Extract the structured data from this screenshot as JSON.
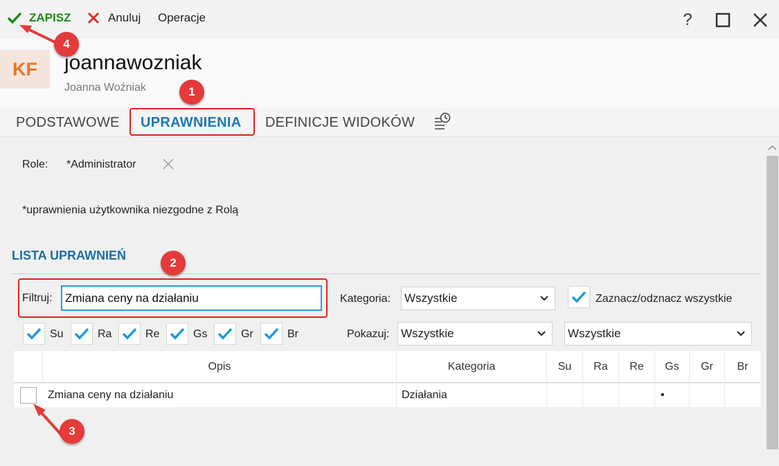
{
  "toolbar": {
    "save_label": "ZAPISZ",
    "cancel_label": "Anuluj",
    "operations_label": "Operacje",
    "help_label": "?"
  },
  "header": {
    "avatar_initials": "KF",
    "username": "joannawozniak",
    "full_name": "Joanna Woźniak"
  },
  "tabs": [
    {
      "label": "PODSTAWOWE",
      "active": false
    },
    {
      "label": "UPRAWNIENIA",
      "active": true
    },
    {
      "label": "DEFINICJE WIDOKÓW",
      "active": false
    }
  ],
  "roles": {
    "label": "Role:",
    "value": "*Administrator"
  },
  "note": "*uprawnienia użytkownika niezgodne z Rolą",
  "permissions": {
    "section_title": "LISTA UPRAWNIEŃ",
    "filter_label": "Filtruj:",
    "filter_value": "Zmiana ceny na działaniu",
    "category_label": "Kategoria:",
    "category_value": "Wszystkie",
    "select_all_label": "Zaznacz/odznacz wszystkie",
    "show_label": "Pokazuj:",
    "show_value": "Wszystkie",
    "show_value_2": "Wszystkie",
    "flags": [
      {
        "label": "Su",
        "checked": true
      },
      {
        "label": "Ra",
        "checked": true
      },
      {
        "label": "Re",
        "checked": true
      },
      {
        "label": "Gs",
        "checked": true
      },
      {
        "label": "Gr",
        "checked": true
      },
      {
        "label": "Br",
        "checked": true
      }
    ]
  },
  "table": {
    "columns": [
      "Opis",
      "Kategoria",
      "Su",
      "Ra",
      "Re",
      "Gs",
      "Gr",
      "Br"
    ],
    "rows": [
      {
        "checked": false,
        "opis": "Zmiana ceny na działaniu",
        "kategoria": "Działania",
        "su": "",
        "ra": "",
        "re": "",
        "gs": "•",
        "gr": "",
        "br": ""
      }
    ]
  },
  "annotations": [
    "1",
    "2",
    "3",
    "4"
  ],
  "colors": {
    "accent_blue": "#1c79b5",
    "save_green": "#1b8a1b",
    "cancel_red": "#e03030",
    "annotation_red": "#e53a3a"
  }
}
